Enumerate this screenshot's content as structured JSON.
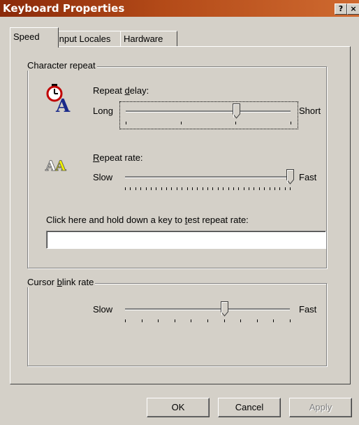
{
  "window": {
    "title": "Keyboard Properties",
    "help_glyph": "?",
    "close_glyph": "×"
  },
  "tabs": [
    "Speed",
    "Input Locales",
    "Hardware"
  ],
  "character_repeat": {
    "group_label": "Character repeat",
    "delay": {
      "label": "Repeat delay:",
      "left": "Long",
      "right": "Short",
      "value_fraction": 0.67
    },
    "rate": {
      "label": "Repeat rate:",
      "left": "Slow",
      "right": "Fast",
      "value_fraction": 1.0
    },
    "test_prompt": "Click here and hold down a key to test repeat rate:",
    "test_value": ""
  },
  "cursor_blink": {
    "group_label": "Cursor blink rate",
    "left": "Slow",
    "right": "Fast",
    "value_fraction": 0.6
  },
  "buttons": {
    "ok": "OK",
    "cancel": "Cancel",
    "apply": "Apply"
  },
  "icons": {
    "delay": "stopwatch-letter-a-icon",
    "rate": "double-letter-a-icon"
  }
}
